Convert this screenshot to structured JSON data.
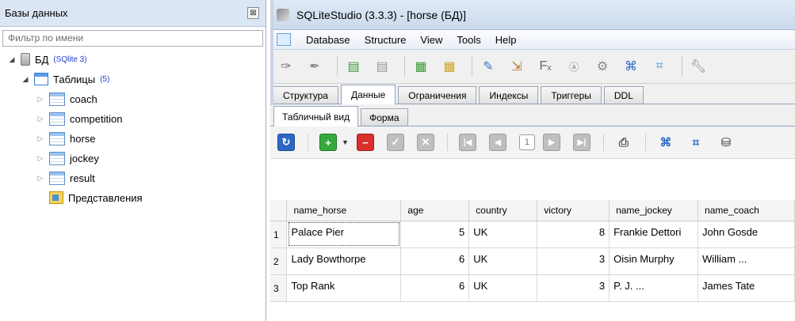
{
  "left_panel": {
    "title": "Базы данных",
    "filter_placeholder": "Фильтр по имени",
    "db": {
      "name": "БД",
      "badge": "(SQlite 3)"
    },
    "tables_node": {
      "label": "Таблицы",
      "count": "(5)"
    },
    "tables": [
      "coach",
      "competition",
      "horse",
      "jockey",
      "result"
    ],
    "views_label": "Представления"
  },
  "window": {
    "title": "SQLiteStudio (3.3.3) - [horse (БД)]",
    "menu": [
      "Database",
      "Structure",
      "View",
      "Tools",
      "Help"
    ]
  },
  "tabs": [
    "Структура",
    "Данные",
    "Ограничения",
    "Индексы",
    "Триггеры",
    "DDL"
  ],
  "subtabs": [
    "Табличный вид",
    "Форма"
  ],
  "pagination": {
    "page": "1"
  },
  "grid": {
    "columns": [
      "name_horse",
      "age",
      "country",
      "victory",
      "name_jockey",
      "name_coach"
    ],
    "rows": [
      {
        "num": "1",
        "name_horse": "Palace Pier",
        "age": "5",
        "country": "UK",
        "victory": "8",
        "name_jockey": "Frankie Dettori",
        "name_coach": "John Gosde"
      },
      {
        "num": "2",
        "name_horse": "Lady Bowthorpe",
        "age": "6",
        "country": "UK",
        "victory": "3",
        "name_jockey": "Oisin Murphy",
        "name_coach": "William ..."
      },
      {
        "num": "3",
        "name_horse": "Top Rank",
        "age": "6",
        "country": "UK",
        "victory": "3",
        "name_jockey": "P. J. ...",
        "name_coach": "James Tate"
      }
    ]
  },
  "colors": {
    "badge": "#1f3fd1",
    "title_bg": "#dbe6f4",
    "refresh": "#2e67c3",
    "add": "#37a83c",
    "delete": "#d9302c"
  },
  "icons": {
    "toolbar": [
      "connect-icon",
      "disconnect-icon",
      "add-db-icon",
      "remove-db-icon",
      "add-table-icon",
      "edit-table-icon",
      "sql-editor-icon",
      "import-icon",
      "function-icon",
      "collation-icon",
      "extension-icon",
      "export-icon",
      "shrink-icon",
      "config-icon"
    ],
    "data_toolbar": [
      "refresh-icon",
      "add-row-icon",
      "dropdown-icon",
      "delete-row-icon",
      "commit-icon",
      "rollback-icon",
      "first-page-icon",
      "prev-page-icon",
      "next-page-icon",
      "last-page-icon",
      "print-icon",
      "expand-icon",
      "collapse-icon",
      "filter-icon"
    ]
  }
}
